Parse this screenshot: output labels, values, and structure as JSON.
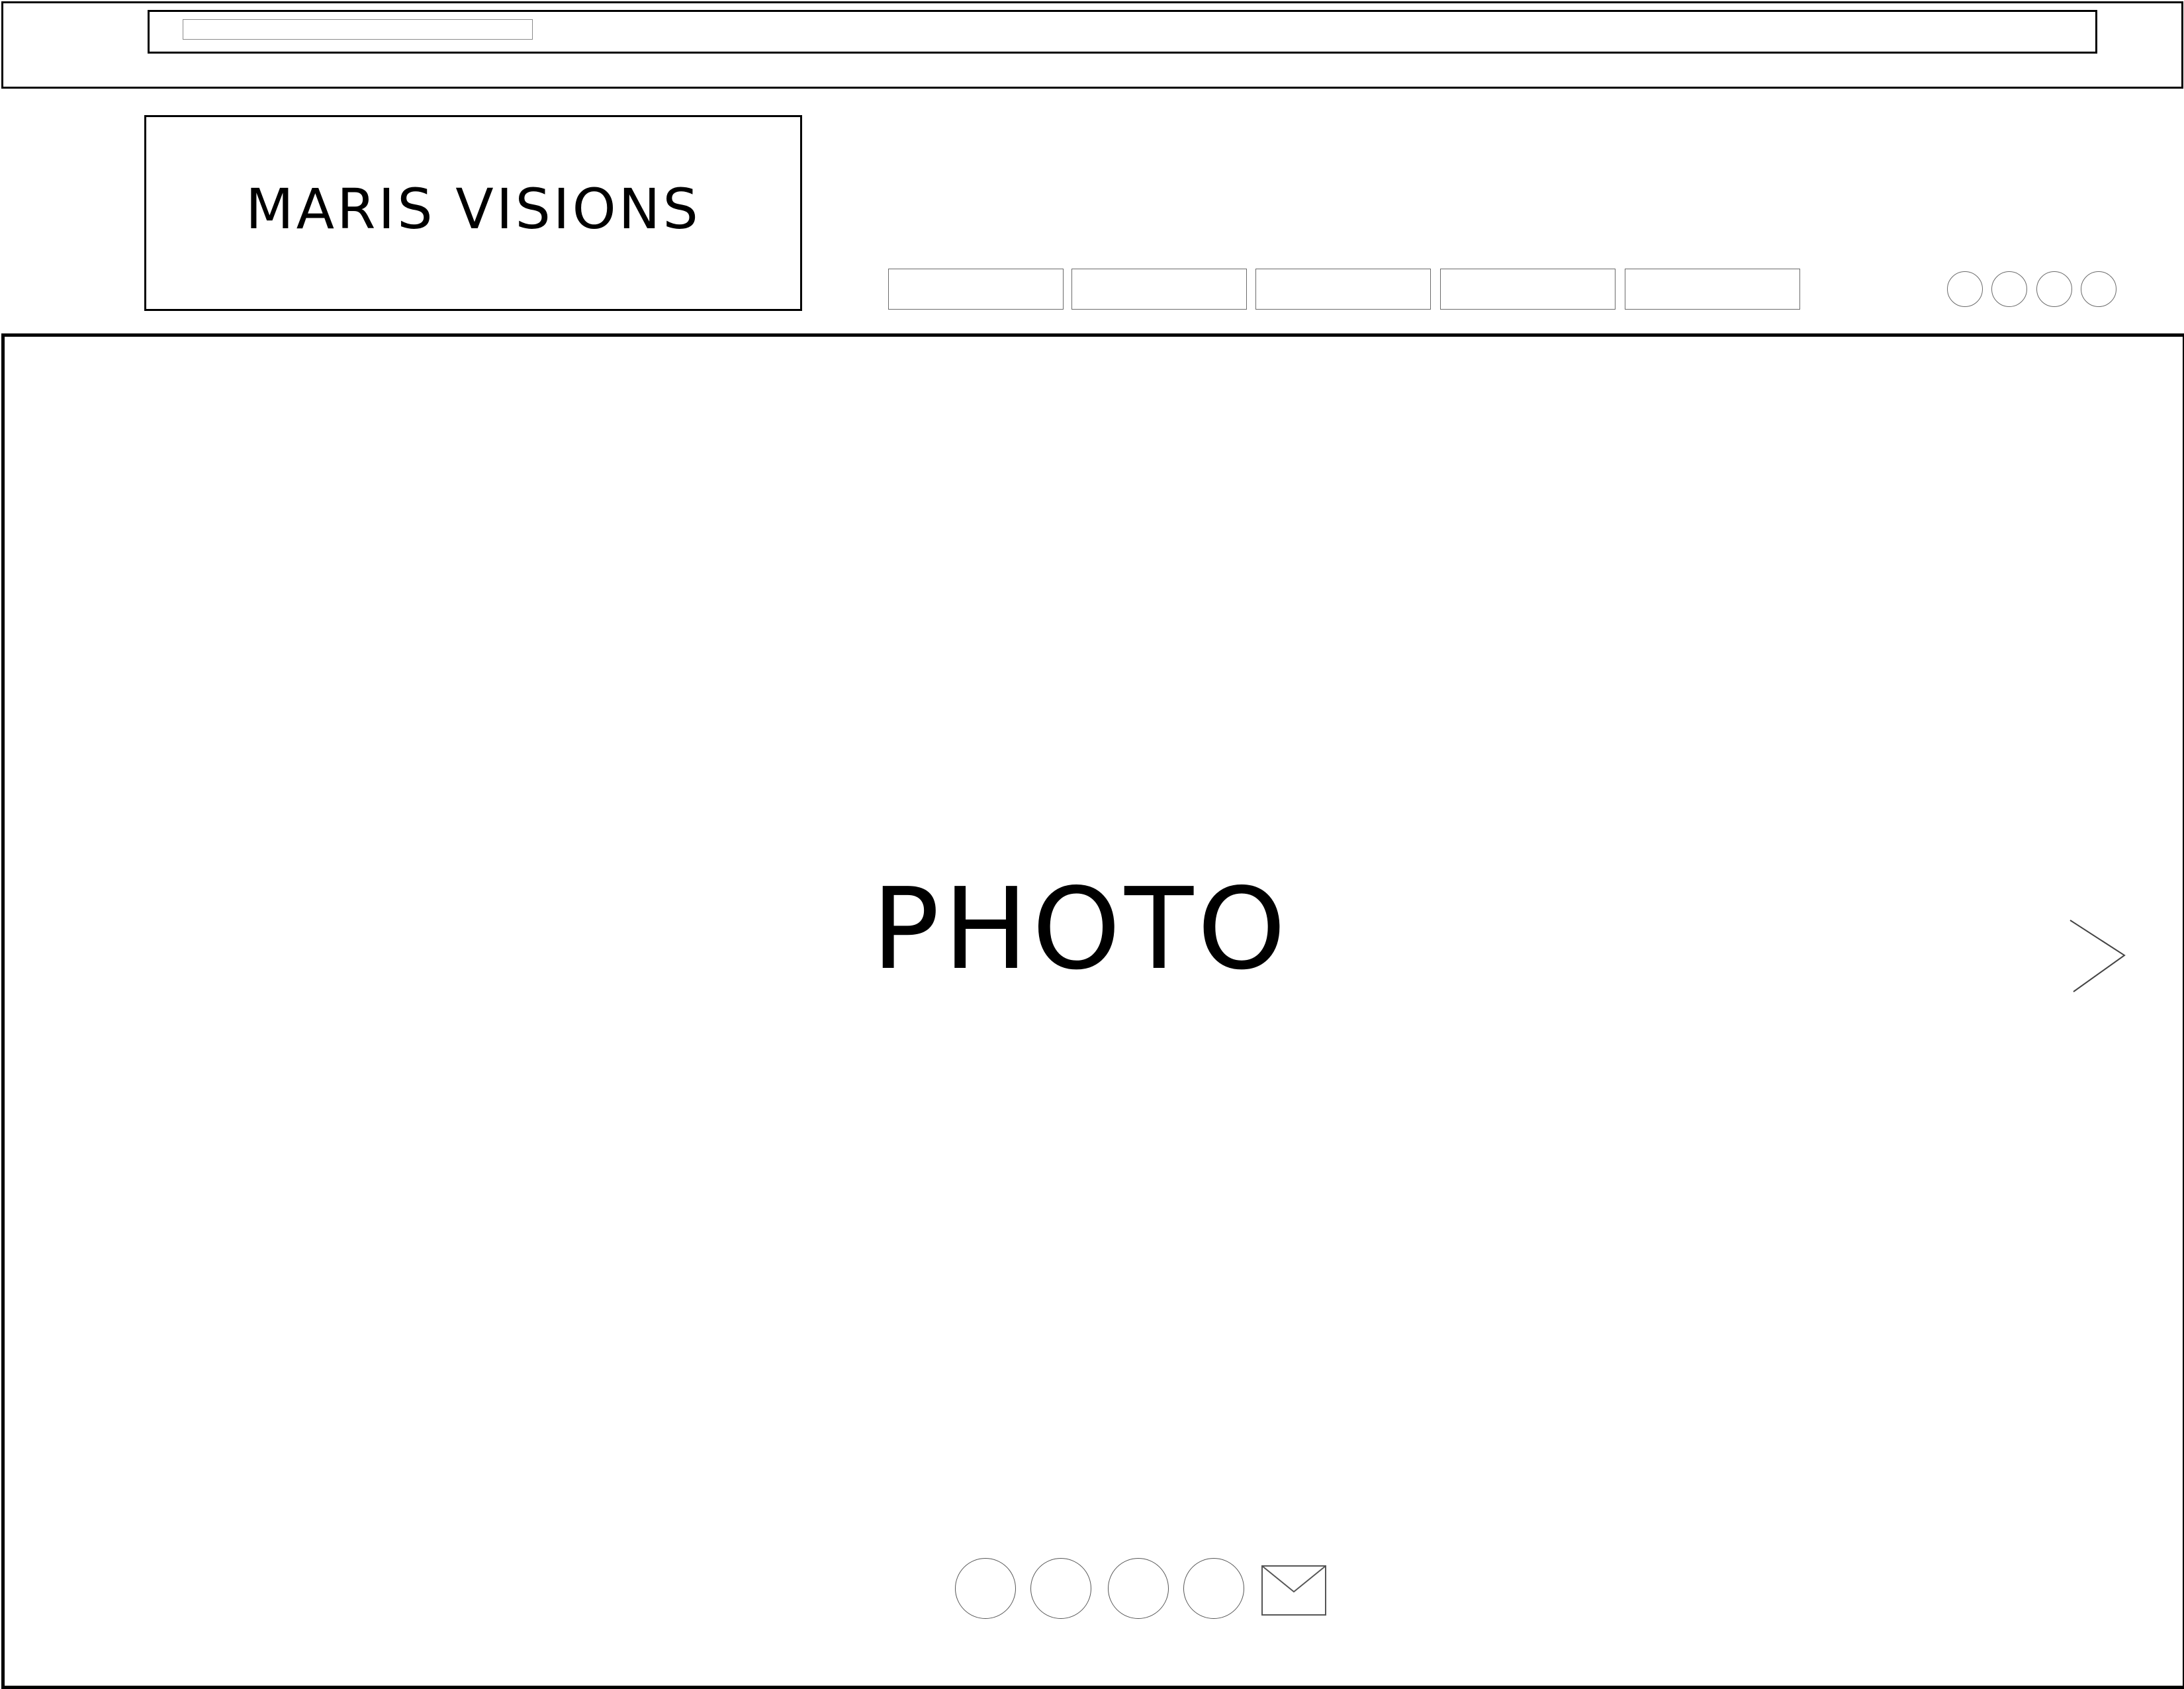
{
  "browser": {
    "address_field": ""
  },
  "header": {
    "logo_text": "MARIS VISIONS",
    "nav_items": [
      "",
      "",
      "",
      "",
      ""
    ],
    "social_icons": [
      "social-icon",
      "social-icon",
      "social-icon",
      "social-icon"
    ]
  },
  "hero": {
    "title": "PHOTO",
    "next_icon": "chevron-right-icon"
  },
  "footer": {
    "social_icons": [
      "social-icon",
      "social-icon",
      "social-icon",
      "social-icon"
    ],
    "mail_icon": "envelope-icon"
  }
}
